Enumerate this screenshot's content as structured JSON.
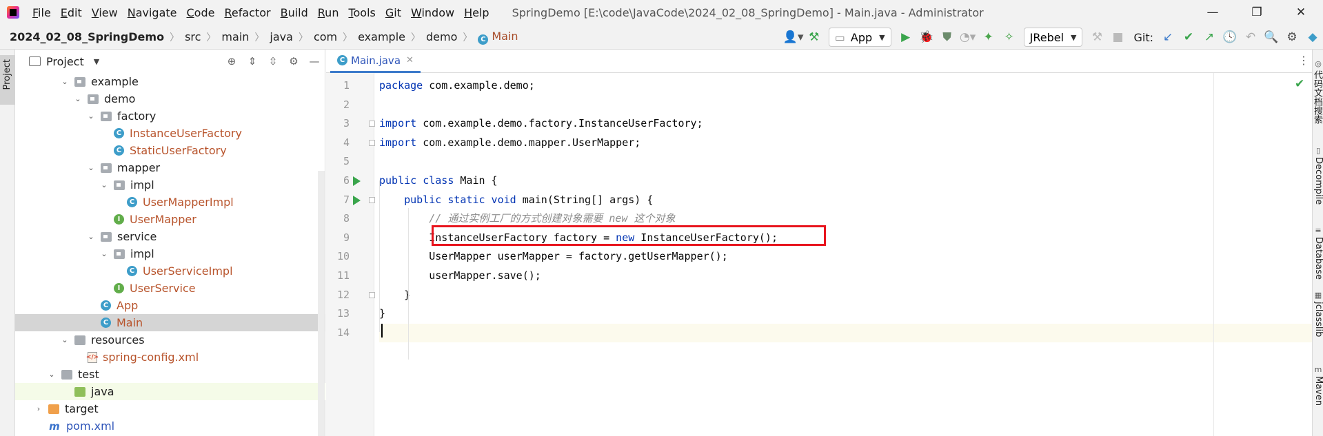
{
  "titlebar": {
    "menu": [
      {
        "u": "F",
        "rest": "ile"
      },
      {
        "u": "E",
        "rest": "dit"
      },
      {
        "u": "V",
        "rest": "iew"
      },
      {
        "u": "N",
        "rest": "avigate"
      },
      {
        "u": "C",
        "rest": "ode"
      },
      {
        "u": "R",
        "rest": "efactor"
      },
      {
        "u": "B",
        "rest": "uild"
      },
      {
        "u": "R",
        "rest": "un"
      },
      {
        "u": "T",
        "rest": "ools"
      },
      {
        "u": "G",
        "rest": "it"
      },
      {
        "u": "W",
        "rest": "indow"
      },
      {
        "u": "H",
        "rest": "elp"
      }
    ],
    "window_title": "SpringDemo [E:\\code\\JavaCode\\2024_02_08_SpringDemo] - Main.java - Administrator",
    "minimize": "—",
    "maximize": "❐",
    "close": "✕"
  },
  "navbar": {
    "crumbs": [
      "2024_02_08_SpringDemo",
      "src",
      "main",
      "java",
      "com",
      "example",
      "demo"
    ],
    "active_crumb": "Main",
    "active_crumb_icon": "C",
    "separator": "〉",
    "run_config": "App",
    "jrebel": "JRebel",
    "git_label": "Git:"
  },
  "left_strip": {
    "project_tab": "Project"
  },
  "project_panel": {
    "title": "Project",
    "tree": [
      {
        "label": "example",
        "indent": 1,
        "arrow": "⌄",
        "icon": "folder",
        "color": "default"
      },
      {
        "label": "demo",
        "indent": 2,
        "arrow": "⌄",
        "icon": "folder",
        "color": "default"
      },
      {
        "label": "factory",
        "indent": 3,
        "arrow": "⌄",
        "icon": "folder",
        "color": "default"
      },
      {
        "label": "InstanceUserFactory",
        "indent": 4,
        "arrow": "",
        "icon": "class",
        "color": "orange"
      },
      {
        "label": "StaticUserFactory",
        "indent": 4,
        "arrow": "",
        "icon": "class",
        "color": "orange"
      },
      {
        "label": "mapper",
        "indent": 3,
        "arrow": "⌄",
        "icon": "folder",
        "color": "default"
      },
      {
        "label": "impl",
        "indent": 4,
        "arrow": "⌄",
        "icon": "folder",
        "color": "default"
      },
      {
        "label": "UserMapperImpl",
        "indent": 5,
        "arrow": "",
        "icon": "class",
        "color": "orange"
      },
      {
        "label": "UserMapper",
        "indent": 4,
        "arrow": "",
        "icon": "interface",
        "color": "orange"
      },
      {
        "label": "service",
        "indent": 3,
        "arrow": "⌄",
        "icon": "folder",
        "color": "default"
      },
      {
        "label": "impl",
        "indent": 4,
        "arrow": "⌄",
        "icon": "folder",
        "color": "default"
      },
      {
        "label": "UserServiceImpl",
        "indent": 5,
        "arrow": "",
        "icon": "class",
        "color": "orange"
      },
      {
        "label": "UserService",
        "indent": 4,
        "arrow": "",
        "icon": "interface",
        "color": "orange"
      },
      {
        "label": "App",
        "indent": 3,
        "arrow": "",
        "icon": "class",
        "color": "orange"
      },
      {
        "label": "Main",
        "indent": 3,
        "arrow": "",
        "icon": "class",
        "color": "orange",
        "selected": true
      },
      {
        "label": "resources",
        "indent": 1,
        "arrow": "⌄",
        "icon": "folder-res",
        "color": "default"
      },
      {
        "label": "spring-config.xml",
        "indent": 2,
        "arrow": "",
        "icon": "xml",
        "color": "orange"
      },
      {
        "label": "test",
        "indent": 0,
        "arrow": "⌄",
        "icon": "folder-plain",
        "color": "default"
      },
      {
        "label": "java",
        "indent": 1,
        "arrow": "",
        "icon": "folder-green",
        "color": "default",
        "highlight": true
      },
      {
        "label": "target",
        "indent": -1,
        "arrow": "›",
        "icon": "folder-orange",
        "color": "default"
      },
      {
        "label": "pom.xml",
        "indent": -1,
        "arrow": "",
        "icon": "maven",
        "color": "blue"
      }
    ]
  },
  "editor": {
    "tab_label": "Main.java",
    "tab_close": "✕",
    "lines": [
      {
        "n": "1",
        "html": "<span class='kw'>package</span> com.example.demo;"
      },
      {
        "n": "2",
        "html": ""
      },
      {
        "n": "3",
        "html": "<span class='kw'>import</span> com.example.demo.factory.InstanceUserFactory;"
      },
      {
        "n": "4",
        "html": "<span class='kw'>import</span> com.example.demo.mapper.UserMapper;"
      },
      {
        "n": "5",
        "html": ""
      },
      {
        "n": "6",
        "html": "<span class='kw'>public class</span> Main {"
      },
      {
        "n": "7",
        "html": "    <span class='kw'>public static void</span> main(String[] args) {"
      },
      {
        "n": "8",
        "html": "        <span class='cm'>// 通过实例工厂的方式创建对象需要 new 这个对象</span>"
      },
      {
        "n": "9",
        "html": "        InstanceUserFactory factory = <span class='kw'>new</span> InstanceUserFactory();"
      },
      {
        "n": "10",
        "html": "        UserMapper userMapper = factory.getUserMapper();"
      },
      {
        "n": "11",
        "html": "        userMapper.save();"
      },
      {
        "n": "12",
        "html": "    }"
      },
      {
        "n": "13",
        "html": "}"
      },
      {
        "n": "14",
        "html": ""
      }
    ]
  },
  "right_strip": {
    "tabs": [
      "代码文档搜索",
      "Decompile",
      "Database",
      "jclasslib",
      "Maven"
    ]
  },
  "colors": {
    "highlight_box": "#e8141d",
    "keyword": "#0033b3",
    "comment": "#8c8c8c",
    "run_green": "#3aa54c"
  }
}
